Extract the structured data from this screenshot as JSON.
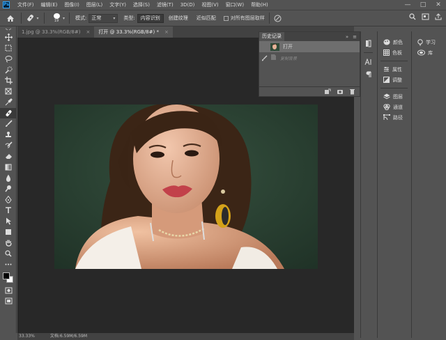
{
  "app": {
    "logo": "Ps"
  },
  "menu": [
    "文件(F)",
    "编辑(E)",
    "图像(I)",
    "图层(L)",
    "文字(Y)",
    "选择(S)",
    "滤镜(T)",
    "3D(D)",
    "视图(V)",
    "窗口(W)",
    "帮助(H)"
  ],
  "window_controls": [
    "—",
    "□",
    "✕"
  ],
  "options": {
    "brush_size": "19",
    "mode_label": "模式:",
    "mode_value": "正常",
    "type_label": "类型:",
    "type_buttons": [
      "内容识别",
      "创建纹理",
      "近似匹配"
    ],
    "sample_all_layers": "对所有图层取样"
  },
  "tabs": [
    {
      "label": "1.jpg @ 33.3%(RGB/8#)",
      "close": "×"
    },
    {
      "label": "打开 @ 33.3%(RGB/8#) *",
      "close": "×"
    }
  ],
  "history": {
    "title": "历史记录",
    "rows": [
      {
        "label": "打开"
      },
      {
        "label": "复制背景"
      }
    ]
  },
  "dock_a": {
    "group1": [
      "颜色",
      "色板"
    ],
    "group2": [
      "属性",
      "调整"
    ],
    "group3": [
      "图层",
      "通道",
      "路径"
    ]
  },
  "dock_b": [
    "学习",
    "库"
  ],
  "status": {
    "zoom": "33.33%",
    "doc": "文档:6.59M/6.59M"
  },
  "colors": {
    "accent": "#31a8ff",
    "ui_bg": "#535353",
    "canvas_bg": "#282828",
    "photo_bg": "#2f4a38"
  },
  "icons": [
    "home-icon",
    "healing-brush-icon",
    "settings-icon",
    "search-icon",
    "frame-icon",
    "share-icon"
  ]
}
